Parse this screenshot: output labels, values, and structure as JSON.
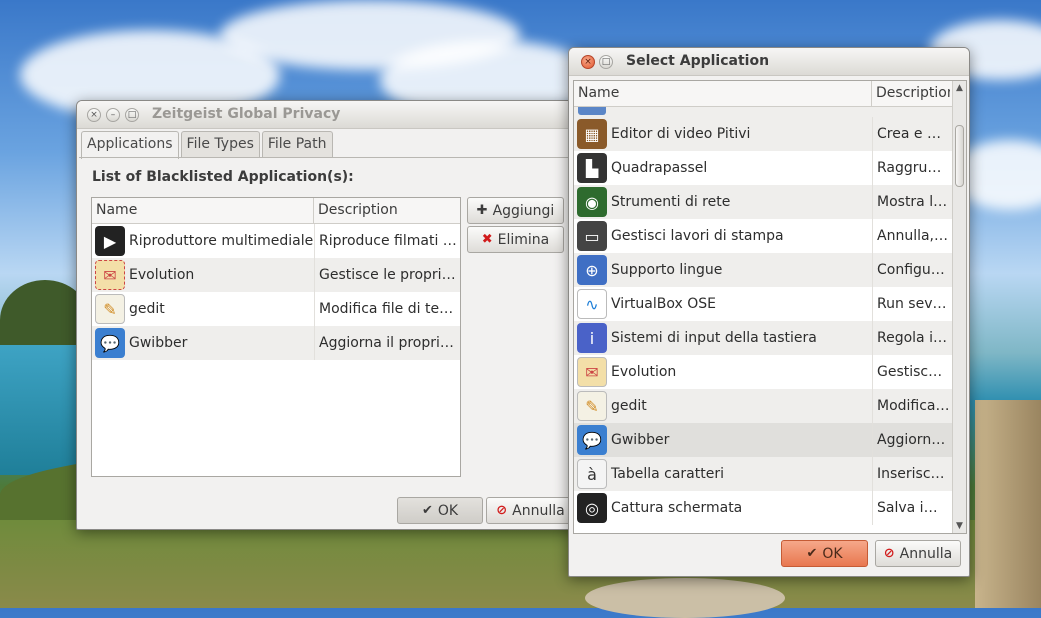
{
  "privacy_window": {
    "title": "Zeitgeist Global Privacy",
    "tabs": [
      "Applications",
      "File Types",
      "File Path"
    ],
    "section_label": "List of Blacklisted Application(s):",
    "columns": [
      "Name",
      "Description"
    ],
    "rows": [
      {
        "name": "Riproduttore multimediale",
        "desc": "Riproduce filmati …",
        "icon": "video-clapper-icon"
      },
      {
        "name": "Evolution",
        "desc": "Gestisce le propri…",
        "icon": "evolution-mail-icon"
      },
      {
        "name": "gedit",
        "desc": "Modifica file di te…",
        "icon": "gedit-pencil-icon"
      },
      {
        "name": "Gwibber",
        "desc": "Aggiorna il propri…",
        "icon": "gwibber-speech-icon"
      }
    ],
    "add_label": "Aggiungi",
    "remove_label": "Elimina",
    "ok_label": "OK",
    "cancel_label": "Annulla"
  },
  "select_window": {
    "title": "Select Application",
    "columns": [
      "Name",
      "Description"
    ],
    "rows": [
      {
        "name": "Editor di video Pitivi",
        "desc": "Crea e m…",
        "icon": "pitivi-film-icon"
      },
      {
        "name": "Quadrapassel",
        "desc": "Raggrup…",
        "icon": "quadrapassel-blocks-icon"
      },
      {
        "name": "Strumenti di rete",
        "desc": "Mostra le…",
        "icon": "radar-network-icon"
      },
      {
        "name": "Gestisci lavori di stampa",
        "desc": "Annulla, …",
        "icon": "printer-icon"
      },
      {
        "name": "Supporto lingue",
        "desc": "Configur…",
        "icon": "globe-language-icon"
      },
      {
        "name": "VirtualBox OSE",
        "desc": "Run sever…",
        "icon": "virtualbox-monitor-icon"
      },
      {
        "name": "Sistemi di input della tastiera",
        "desc": "Regola i s…",
        "icon": "info-icon"
      },
      {
        "name": "Evolution",
        "desc": "Gestisce l…",
        "icon": "evolution-mail-icon"
      },
      {
        "name": "gedit",
        "desc": "Modifica …",
        "icon": "gedit-pencil-icon"
      },
      {
        "name": "Gwibber",
        "desc": "Aggiorna …",
        "icon": "gwibber-speech-icon"
      },
      {
        "name": "Tabella caratteri",
        "desc": "Inserisce …",
        "icon": "character-map-icon"
      },
      {
        "name": "Cattura schermata",
        "desc": "Salva im…",
        "icon": "camera-lens-icon"
      }
    ],
    "selected_index": 9,
    "ok_label": "OK",
    "cancel_label": "Annulla"
  }
}
